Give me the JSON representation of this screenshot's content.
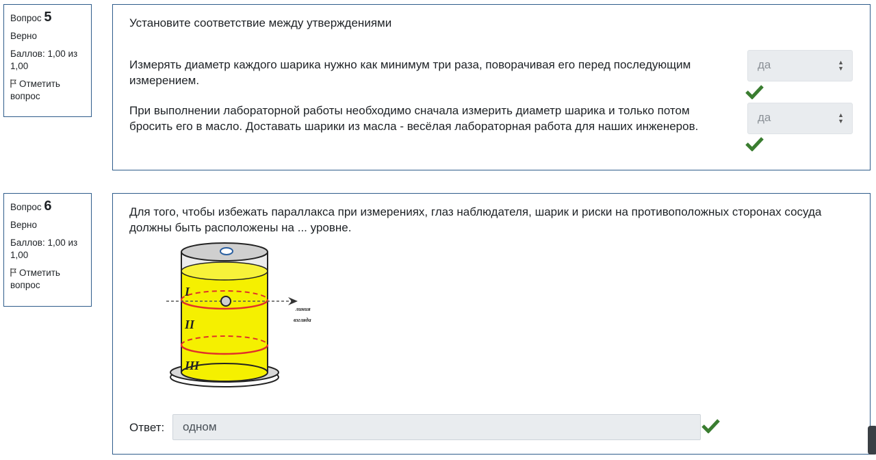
{
  "questions": [
    {
      "label": "Вопрос",
      "number": "5",
      "state": "Верно",
      "grade": "Баллов: 1,00 из 1,00",
      "flag_label": "Отметить вопрос",
      "text": "Установите соответствие между утверждениями",
      "statements": [
        {
          "text": "Измерять диаметр каждого шарика нужно как минимум три раза, поворачивая его перед последующим измерением.",
          "selected": "да",
          "correct": true
        },
        {
          "text": "При выполнении лабораторной работы необходимо сначала измерить диаметр шарика и только потом бросить его в масло. Доставать шарики из масла - весёлая лабораторная работа для наших инженеров.",
          "selected": "да",
          "correct": true
        }
      ]
    },
    {
      "label": "Вопрос",
      "number": "6",
      "state": "Верно",
      "grade": "Баллов: 1,00 из 1,00",
      "flag_label": "Отметить вопрос",
      "text": "Для того, чтобы избежать параллакса при измерениях, глаз наблюдателя, шарик и  риски на противоположных сторонах  сосуда  должны быть расположены на ... уровне.",
      "figure": {
        "zones": [
          "I",
          "II",
          "III"
        ],
        "sightline_label_1": "линия",
        "sightline_label_2": "взгляда"
      },
      "answer_label": "Ответ:",
      "answer_value": "одном",
      "correct": true
    }
  ],
  "colors": {
    "border": "#2d5b8a",
    "check": "#3a7d30",
    "liquid": "#f5f000",
    "ring": "#e0302a",
    "field_bg": "#e9ecef"
  }
}
